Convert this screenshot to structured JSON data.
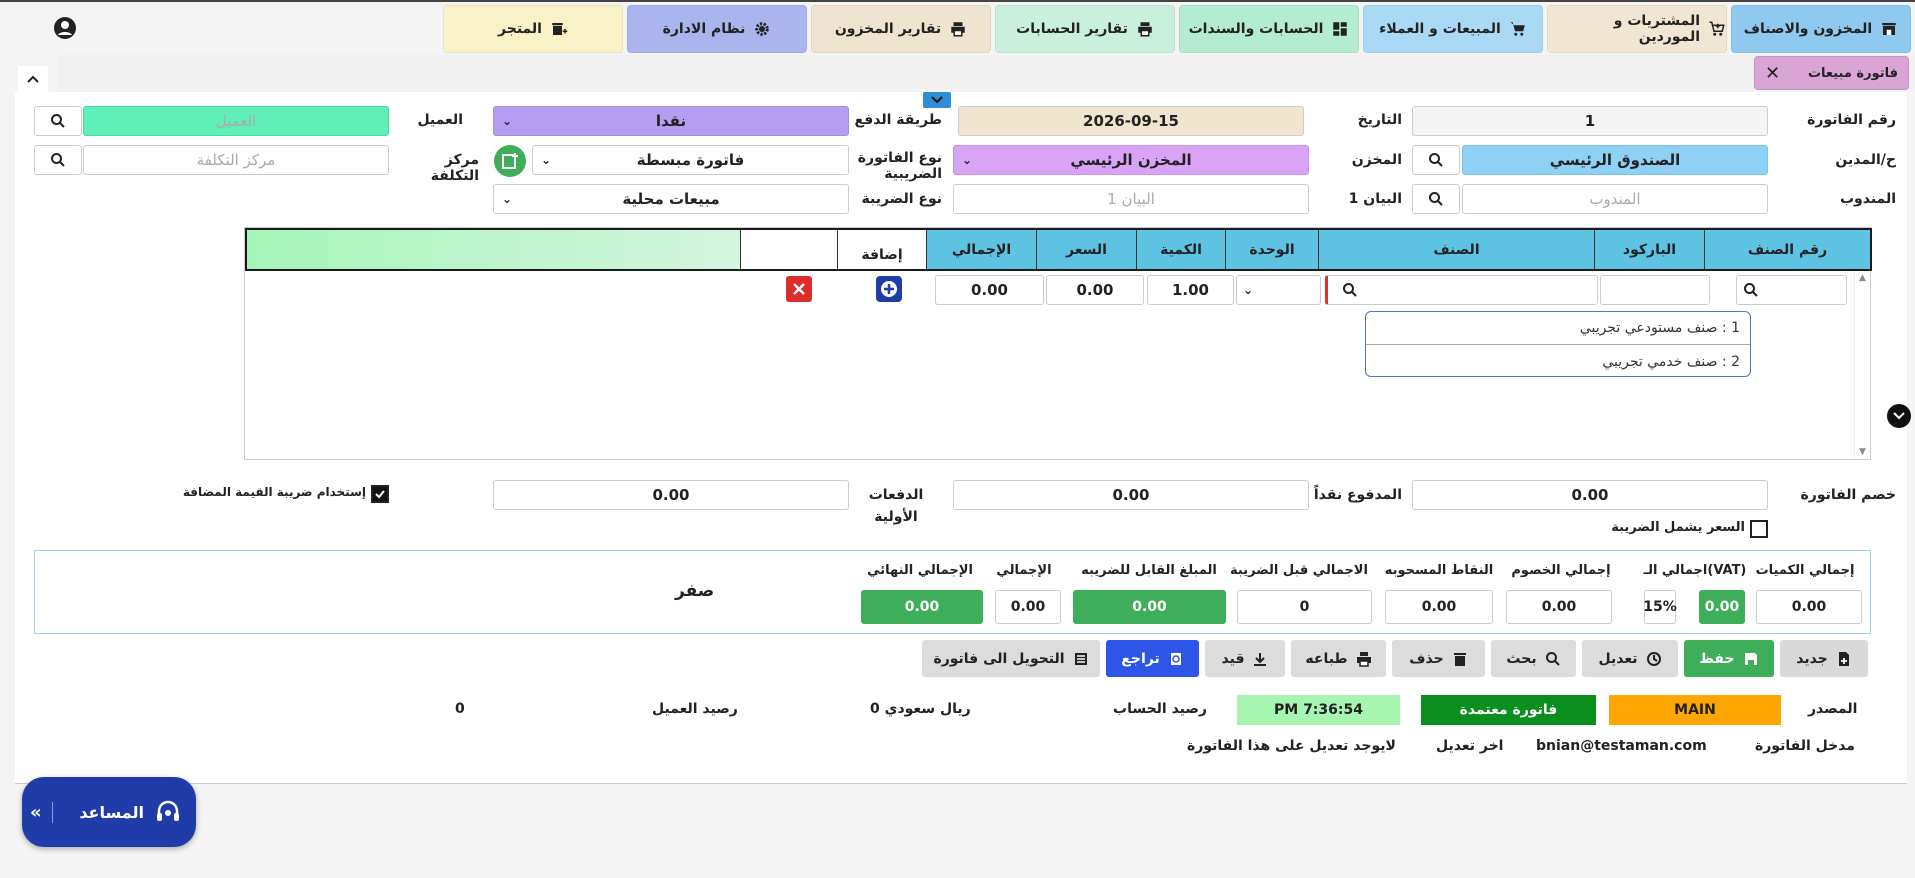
{
  "nav": [
    {
      "label": "المخزون والاصناف",
      "color": "#8fc9f0"
    },
    {
      "label": "المشتريات و الموردين",
      "color": "#f1e6d4"
    },
    {
      "label": "المبيعات و العملاء",
      "color": "#a9d9f5"
    },
    {
      "label": "الحسابات والسندات",
      "color": "#b3ecd0"
    },
    {
      "label": "تقارير الحسابات",
      "color": "#c9f0dc"
    },
    {
      "label": "تقارير المخزون",
      "color": "#efe4cf"
    },
    {
      "label": "نظام الادارة",
      "color": "#a9b5ec"
    },
    {
      "label": "المتجر",
      "color": "#faf2c7"
    }
  ],
  "tab": {
    "label": "فاتورة مبيعات",
    "close": "✕"
  },
  "form": {
    "invoice_no_label": "رقم الفاتورة",
    "invoice_no": "1",
    "date_label": "التاريخ",
    "date": "2026-09-15",
    "payment_label": "طريقة الدفع",
    "payment": "نقدا",
    "client_label": "العميل",
    "client_placeholder": "العميل",
    "debit_label": "ح/المدين",
    "debit": "الصندوق الرئيسي",
    "store_label": "المخزن",
    "store": "المخزن الرئيسي",
    "tax_invoice_type_label": "نوع الفاتورة الضريبية",
    "tax_invoice_type": "فاتورة مبسطة",
    "cost_center_label": "مركز التكلفة",
    "cost_center_placeholder": "مركز التكلفة",
    "rep_label": "المندوب",
    "rep_placeholder": "المندوب",
    "statement_label": "البيان 1",
    "statement_placeholder": "البيان 1",
    "tax_type_label": "نوع الضريبة",
    "tax_type": "مبيعات محلية"
  },
  "grid": {
    "headers": [
      "رقم الصنف",
      "الباركود",
      "الصنف",
      "الوحدة",
      "الكمية",
      "السعر",
      "الإجمالي",
      "إضافة",
      ""
    ],
    "row": {
      "qty": "1.00",
      "price": "0.00",
      "total": "0.00"
    },
    "suggestions": [
      "1 : صنف مستودعي تجريبي",
      "2 : صنف خدمي تجريبي"
    ]
  },
  "payments": {
    "discount_label": "خصم الفاتورة",
    "discount": "0.00",
    "paid_label": "المدفوع نقداً",
    "paid": "0.00",
    "advance_label": "الدفعات الأولية",
    "advance": "0.00",
    "vat_check_label": "إستخدام ضريبة القيمة المضافة",
    "price_incl_tax_label": "السعر يشمل الضريبة"
  },
  "summary": {
    "total_qty_label": "إجمالي الكميات",
    "total_qty": "0.00",
    "vat_label": "اجمالي الـ(VAT)",
    "vat": "0.00",
    "vat_rate": "15%",
    "discounts_label": "إجمالي الخصوم",
    "discounts": "0.00",
    "points_label": "النقاط المسحوبه",
    "points": "0.00",
    "before_tax_label": "الاجمالي قبل الضريبة",
    "before_tax": "0",
    "taxable_label": "المبلغ القابل للضريبه",
    "taxable": "0.00",
    "total_label": "الإجمالي",
    "total": "0.00",
    "final_label": "الإجمالي النهائي",
    "final": "0.00",
    "in_words": "صفر"
  },
  "actions": {
    "new": "جديد",
    "save": "حفظ",
    "edit": "تعديل",
    "search": "بحث",
    "delete": "حذف",
    "print": "طباعه",
    "post": "قيد",
    "undo": "تراجع",
    "convert": "التحويل الى فاتورة"
  },
  "footer": {
    "source_label": "المصدر",
    "source": "MAIN",
    "status": "فاتورة معتمدة",
    "time": "PM 7:36:54",
    "account_balance_label": "رصيد الحساب",
    "account_balance": "0 ريال سعودي",
    "client_balance_label": "رصيد العميل",
    "client_balance": "0",
    "entered_by_label": "مدخل الفاتورة",
    "entered_by": "bnian@testaman.com",
    "last_edit_label": "اخر تعديل",
    "last_edit": "لايوجد تعديل على هذا الفاتورة"
  },
  "assistant": {
    "label": "المساعد"
  },
  "colors": {
    "teal": "#5ec3e3",
    "green": "#3fae5a",
    "purple": "#b59df2",
    "yellow": "#ffa500",
    "statusGreen": "#0a8f1e"
  }
}
